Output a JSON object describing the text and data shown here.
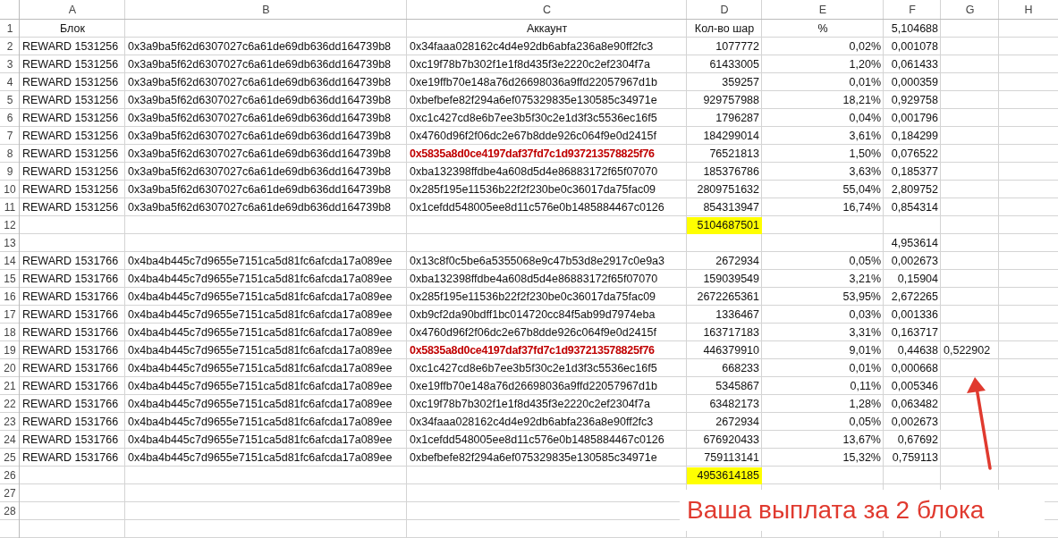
{
  "columns": [
    "A",
    "B",
    "C",
    "D",
    "E",
    "F",
    "G",
    "H"
  ],
  "rows": [
    {
      "number": "1",
      "kind": "header",
      "block": "Блок",
      "account": "Аккаунт",
      "shares": "Кол-во шар",
      "percent": "%",
      "amount": "5,104688"
    },
    {
      "number": "2",
      "kind": "data",
      "block": "REWARD 1531256",
      "tx": "0x3a9ba5f62d6307027c6a61de69db636dd164739b8",
      "account": "0x34faaa028162c4d4e92db6abfa236a8e90ff2fc3",
      "flagged": false,
      "shares": "1077772",
      "percent": "0,02%",
      "amount": "0,001078"
    },
    {
      "number": "3",
      "kind": "data",
      "block": "REWARD 1531256",
      "tx": "0x3a9ba5f62d6307027c6a61de69db636dd164739b8",
      "account": "0xc19f78b7b302f1e1f8d435f3e2220c2ef2304f7a",
      "flagged": false,
      "shares": "61433005",
      "percent": "1,20%",
      "amount": "0,061433"
    },
    {
      "number": "4",
      "kind": "data",
      "block": "REWARD 1531256",
      "tx": "0x3a9ba5f62d6307027c6a61de69db636dd164739b8",
      "account": "0xe19ffb70e148a76d26698036a9ffd22057967d1b",
      "flagged": false,
      "shares": "359257",
      "percent": "0,01%",
      "amount": "0,000359"
    },
    {
      "number": "5",
      "kind": "data",
      "block": "REWARD 1531256",
      "tx": "0x3a9ba5f62d6307027c6a61de69db636dd164739b8",
      "account": "0xbefbefe82f294a6ef075329835e130585c34971e",
      "flagged": false,
      "shares": "929757988",
      "percent": "18,21%",
      "amount": "0,929758"
    },
    {
      "number": "6",
      "kind": "data",
      "block": "REWARD 1531256",
      "tx": "0x3a9ba5f62d6307027c6a61de69db636dd164739b8",
      "account": "0xc1c427cd8e6b7ee3b5f30c2e1d3f3c5536ec16f5",
      "flagged": false,
      "shares": "1796287",
      "percent": "0,04%",
      "amount": "0,001796"
    },
    {
      "number": "7",
      "kind": "data",
      "block": "REWARD 1531256",
      "tx": "0x3a9ba5f62d6307027c6a61de69db636dd164739b8",
      "account": "0x4760d96f2f06dc2e67b8dde926c064f9e0d2415f",
      "flagged": false,
      "shares": "184299014",
      "percent": "3,61%",
      "amount": "0,184299"
    },
    {
      "number": "8",
      "kind": "data",
      "block": "REWARD 1531256",
      "tx": "0x3a9ba5f62d6307027c6a61de69db636dd164739b8",
      "account": "0x5835a8d0ce4197daf37fd7c1d937213578825f76",
      "flagged": true,
      "shares": "76521813",
      "percent": "1,50%",
      "amount": "0,076522"
    },
    {
      "number": "9",
      "kind": "data",
      "block": "REWARD 1531256",
      "tx": "0x3a9ba5f62d6307027c6a61de69db636dd164739b8",
      "account": "0xba132398ffdbe4a608d5d4e86883172f65f07070",
      "flagged": false,
      "shares": "185376786",
      "percent": "3,63%",
      "amount": "0,185377"
    },
    {
      "number": "10",
      "kind": "data",
      "block": "REWARD 1531256",
      "tx": "0x3a9ba5f62d6307027c6a61de69db636dd164739b8",
      "account": "0x285f195e11536b22f2f230be0c36017da75fac09",
      "flagged": false,
      "shares": "2809751632",
      "percent": "55,04%",
      "amount": "2,809752"
    },
    {
      "number": "11",
      "kind": "data",
      "block": "REWARD 1531256",
      "tx": "0x3a9ba5f62d6307027c6a61de69db636dd164739b8",
      "account": "0x1cefdd548005ee8d11c576e0b1485884467c0126",
      "flagged": false,
      "shares": "854313947",
      "percent": "16,74%",
      "amount": "0,854314"
    },
    {
      "number": "12",
      "kind": "total",
      "shares": "5104687501",
      "highlighted": true
    },
    {
      "number": "13",
      "kind": "total",
      "amount": "4,953614",
      "highlighted": false
    },
    {
      "number": "14",
      "kind": "data",
      "block": "REWARD 1531766",
      "tx": "0x4ba4b445c7d9655e7151ca5d81fc6afcda17a089ee",
      "account": "0x13c8f0c5be6a5355068e9c47b53d8e2917c0e9a3",
      "flagged": false,
      "shares": "2672934",
      "percent": "0,05%",
      "amount": "0,002673"
    },
    {
      "number": "15",
      "kind": "data",
      "block": "REWARD 1531766",
      "tx": "0x4ba4b445c7d9655e7151ca5d81fc6afcda17a089ee",
      "account": "0xba132398ffdbe4a608d5d4e86883172f65f07070",
      "flagged": false,
      "shares": "159039549",
      "percent": "3,21%",
      "amount": "0,15904"
    },
    {
      "number": "16",
      "kind": "data",
      "block": "REWARD 1531766",
      "tx": "0x4ba4b445c7d9655e7151ca5d81fc6afcda17a089ee",
      "account": "0x285f195e11536b22f2f230be0c36017da75fac09",
      "flagged": false,
      "shares": "2672265361",
      "percent": "53,95%",
      "amount": "2,672265"
    },
    {
      "number": "17",
      "kind": "data",
      "block": "REWARD 1531766",
      "tx": "0x4ba4b445c7d9655e7151ca5d81fc6afcda17a089ee",
      "account": "0xb9cf2da90bdff1bc014720cc84f5ab99d7974eba",
      "flagged": false,
      "shares": "1336467",
      "percent": "0,03%",
      "amount": "0,001336"
    },
    {
      "number": "18",
      "kind": "data",
      "block": "REWARD 1531766",
      "tx": "0x4ba4b445c7d9655e7151ca5d81fc6afcda17a089ee",
      "account": "0x4760d96f2f06dc2e67b8dde926c064f9e0d2415f",
      "flagged": false,
      "shares": "163717183",
      "percent": "3,31%",
      "amount": "0,163717"
    },
    {
      "number": "19",
      "kind": "data",
      "block": "REWARD 1531766",
      "tx": "0x4ba4b445c7d9655e7151ca5d81fc6afcda17a089ee",
      "account": "0x5835a8d0ce4197daf37fd7c1d937213578825f76",
      "flagged": true,
      "shares": "446379910",
      "percent": "9,01%",
      "amount": "0,44638",
      "column_g": "0,522902"
    },
    {
      "number": "20",
      "kind": "data",
      "block": "REWARD 1531766",
      "tx": "0x4ba4b445c7d9655e7151ca5d81fc6afcda17a089ee",
      "account": "0xc1c427cd8e6b7ee3b5f30c2e1d3f3c5536ec16f5",
      "flagged": false,
      "shares": "668233",
      "percent": "0,01%",
      "amount": "0,000668"
    },
    {
      "number": "21",
      "kind": "data",
      "block": "REWARD 1531766",
      "tx": "0x4ba4b445c7d9655e7151ca5d81fc6afcda17a089ee",
      "account": "0xe19ffb70e148a76d26698036a9ffd22057967d1b",
      "flagged": false,
      "shares": "5345867",
      "percent": "0,11%",
      "amount": "0,005346"
    },
    {
      "number": "22",
      "kind": "data",
      "block": "REWARD 1531766",
      "tx": "0x4ba4b445c7d9655e7151ca5d81fc6afcda17a089ee",
      "account": "0xc19f78b7b302f1e1f8d435f3e2220c2ef2304f7a",
      "flagged": false,
      "shares": "63482173",
      "percent": "1,28%",
      "amount": "0,063482"
    },
    {
      "number": "23",
      "kind": "data",
      "block": "REWARD 1531766",
      "tx": "0x4ba4b445c7d9655e7151ca5d81fc6afcda17a089ee",
      "account": "0x34faaa028162c4d4e92db6abfa236a8e90ff2fc3",
      "flagged": false,
      "shares": "2672934",
      "percent": "0,05%",
      "amount": "0,002673"
    },
    {
      "number": "24",
      "kind": "data",
      "block": "REWARD 1531766",
      "tx": "0x4ba4b445c7d9655e7151ca5d81fc6afcda17a089ee",
      "account": "0x1cefdd548005ee8d11c576e0b1485884467c0126",
      "flagged": false,
      "shares": "676920433",
      "percent": "13,67%",
      "amount": "0,67692"
    },
    {
      "number": "25",
      "kind": "data",
      "block": "REWARD 1531766",
      "tx": "0x4ba4b445c7d9655e7151ca5d81fc6afcda17a089ee",
      "account": "0xbefbefe82f294a6ef075329835e130585c34971e",
      "flagged": false,
      "shares": "759113141",
      "percent": "15,32%",
      "amount": "0,759113"
    },
    {
      "number": "26",
      "kind": "total",
      "shares": "4953614185",
      "highlighted": true
    },
    {
      "number": "27",
      "kind": "blank"
    },
    {
      "number": "28",
      "kind": "blank"
    }
  ],
  "annotation": {
    "text": "Ваша выплата за 2 блока"
  }
}
